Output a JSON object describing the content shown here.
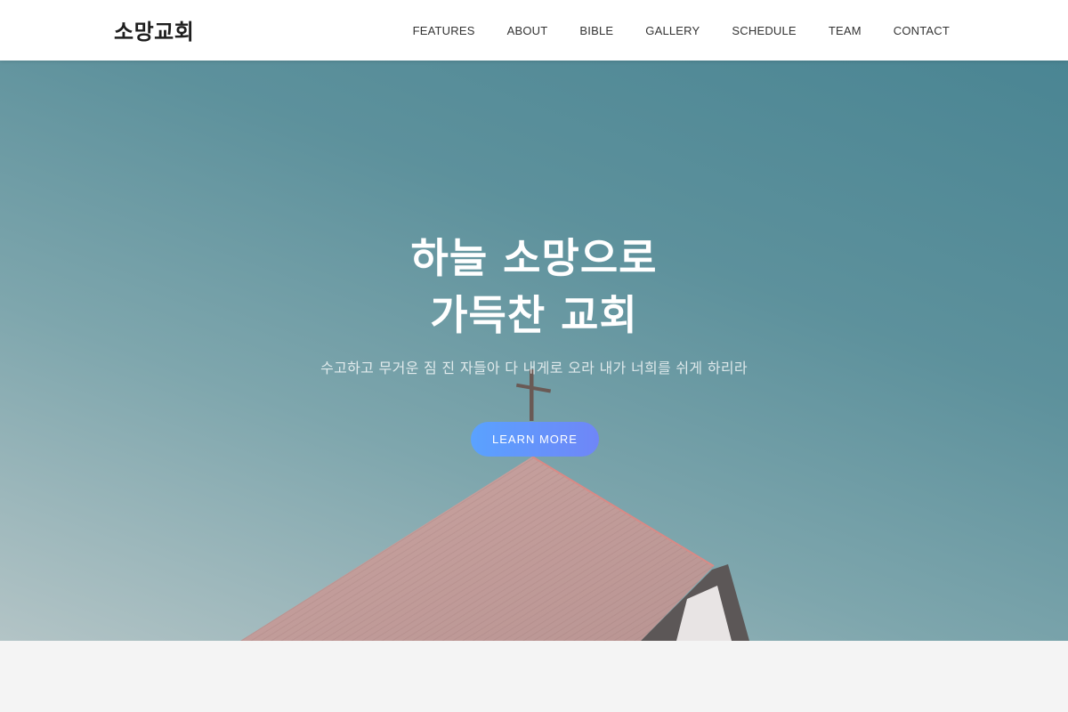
{
  "brand": {
    "name": "소망교회"
  },
  "nav": {
    "items": [
      {
        "label": "FEATURES"
      },
      {
        "label": "ABOUT"
      },
      {
        "label": "BIBLE"
      },
      {
        "label": "GALLERY"
      },
      {
        "label": "SCHEDULE"
      },
      {
        "label": "TEAM"
      },
      {
        "label": "CONTACT"
      }
    ]
  },
  "hero": {
    "title_line1": "하늘 소망으로",
    "title_line2": "가득찬 교회",
    "subtitle": "수고하고 무거운 짐 진 자들아 다 내게로 오라 내가 너희를 쉬게 하리라",
    "cta_label": "LEARN MORE"
  },
  "colors": {
    "navbar_bg": "#ffffff",
    "hero_sky": "#5d919c",
    "roof": "#c79a98",
    "cta_gradient_start": "#5aa2ff",
    "cta_gradient_end": "#6f86f7",
    "footer_bg": "#f4f4f4"
  }
}
